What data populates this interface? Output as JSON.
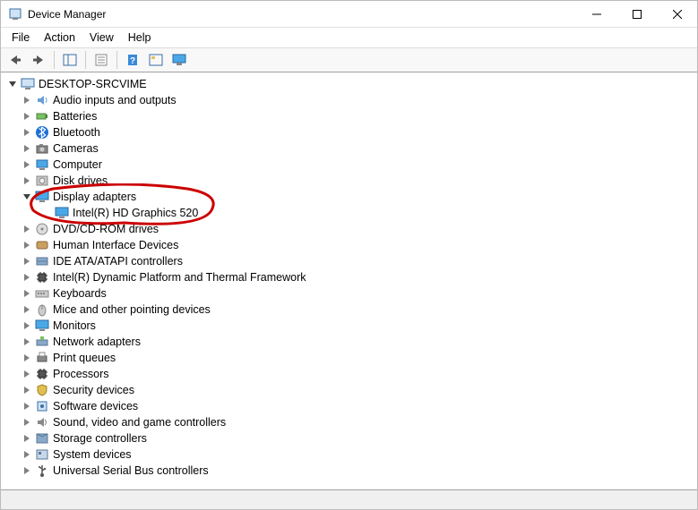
{
  "window": {
    "title": "Device Manager"
  },
  "menubar": [
    "File",
    "Action",
    "View",
    "Help"
  ],
  "root": {
    "name": "DESKTOP-SRCVIME",
    "expanded": true
  },
  "categories": [
    {
      "name": "Audio inputs and outputs",
      "icon": "audio",
      "expanded": false
    },
    {
      "name": "Batteries",
      "icon": "battery",
      "expanded": false
    },
    {
      "name": "Bluetooth",
      "icon": "bluetooth",
      "expanded": false
    },
    {
      "name": "Cameras",
      "icon": "camera",
      "expanded": false
    },
    {
      "name": "Computer",
      "icon": "computer",
      "expanded": false
    },
    {
      "name": "Disk drives",
      "icon": "disk",
      "expanded": false
    },
    {
      "name": "Display adapters",
      "icon": "display",
      "expanded": true,
      "children": [
        {
          "name": "Intel(R) HD Graphics 520",
          "icon": "display"
        }
      ]
    },
    {
      "name": "DVD/CD-ROM drives",
      "icon": "cdrom",
      "expanded": false
    },
    {
      "name": "Human Interface Devices",
      "icon": "hid",
      "expanded": false
    },
    {
      "name": "IDE ATA/ATAPI controllers",
      "icon": "ide",
      "expanded": false
    },
    {
      "name": "Intel(R) Dynamic Platform and Thermal Framework",
      "icon": "chip",
      "expanded": false
    },
    {
      "name": "Keyboards",
      "icon": "keyboard",
      "expanded": false
    },
    {
      "name": "Mice and other pointing devices",
      "icon": "mouse",
      "expanded": false
    },
    {
      "name": "Monitors",
      "icon": "monitor",
      "expanded": false
    },
    {
      "name": "Network adapters",
      "icon": "network",
      "expanded": false
    },
    {
      "name": "Print queues",
      "icon": "printer",
      "expanded": false
    },
    {
      "name": "Processors",
      "icon": "cpu",
      "expanded": false
    },
    {
      "name": "Security devices",
      "icon": "security",
      "expanded": false
    },
    {
      "name": "Software devices",
      "icon": "software",
      "expanded": false
    },
    {
      "name": "Sound, video and game controllers",
      "icon": "sound",
      "expanded": false
    },
    {
      "name": "Storage controllers",
      "icon": "storage",
      "expanded": false
    },
    {
      "name": "System devices",
      "icon": "system",
      "expanded": false
    },
    {
      "name": "Universal Serial Bus controllers",
      "icon": "usb",
      "expanded": false
    }
  ],
  "annotation": {
    "highlighted": "Display adapters",
    "color": "#cc0000"
  }
}
